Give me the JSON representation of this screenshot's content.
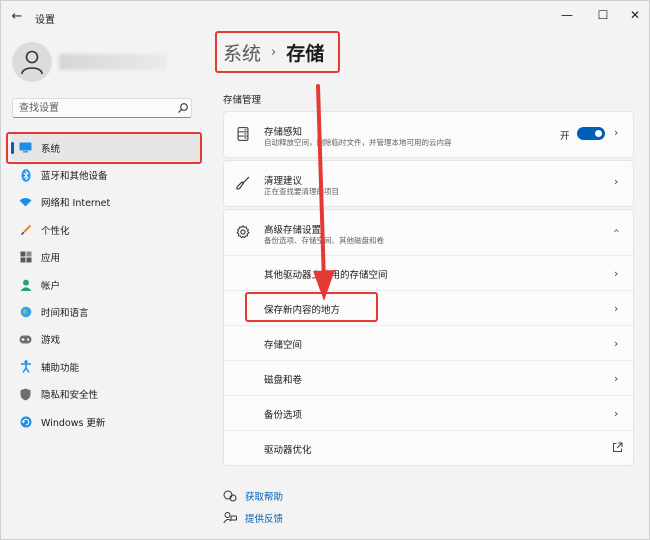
{
  "window": {
    "title": "设置",
    "controls": {
      "minimize": "—",
      "maximize": "☐",
      "close": "✕"
    },
    "back": "←"
  },
  "search": {
    "placeholder": "查找设置"
  },
  "nav": [
    {
      "label": "系统",
      "icon": "system-icon",
      "active": true
    },
    {
      "label": "蓝牙和其他设备",
      "icon": "bluetooth-icon"
    },
    {
      "label": "网络和 Internet",
      "icon": "wifi-icon"
    },
    {
      "label": "个性化",
      "icon": "brush-icon"
    },
    {
      "label": "应用",
      "icon": "apps-icon"
    },
    {
      "label": "帐户",
      "icon": "account-icon"
    },
    {
      "label": "时间和语言",
      "icon": "globe-icon"
    },
    {
      "label": "游戏",
      "icon": "gamepad-icon"
    },
    {
      "label": "辅助功能",
      "icon": "accessibility-icon"
    },
    {
      "label": "隐私和安全性",
      "icon": "shield-icon"
    },
    {
      "label": "Windows 更新",
      "icon": "update-icon"
    }
  ],
  "breadcrumb": {
    "parent": "系统",
    "separator": "›",
    "current": "存储"
  },
  "section": {
    "title": "存储管理"
  },
  "storage_sense": {
    "title": "存储感知",
    "desc": "自动释放空间，删除临时文件，并管理本地可用的云内容",
    "toggle_label": "开",
    "toggle_on": true
  },
  "cleanup": {
    "title": "清理建议",
    "desc": "正在查找要清理的项目"
  },
  "advanced": {
    "title": "高级存储设置",
    "desc": "备份选项、存储空间、其他磁盘和卷",
    "items": [
      "其他驱动器上使用的存储空间",
      "保存新内容的地方",
      "存储空间",
      "磁盘和卷",
      "备份选项",
      "驱动器优化"
    ]
  },
  "help": {
    "get_help": "获取帮助",
    "feedback": "提供反馈"
  },
  "colors": {
    "accent": "#005fb8",
    "highlight": "#e53935"
  }
}
